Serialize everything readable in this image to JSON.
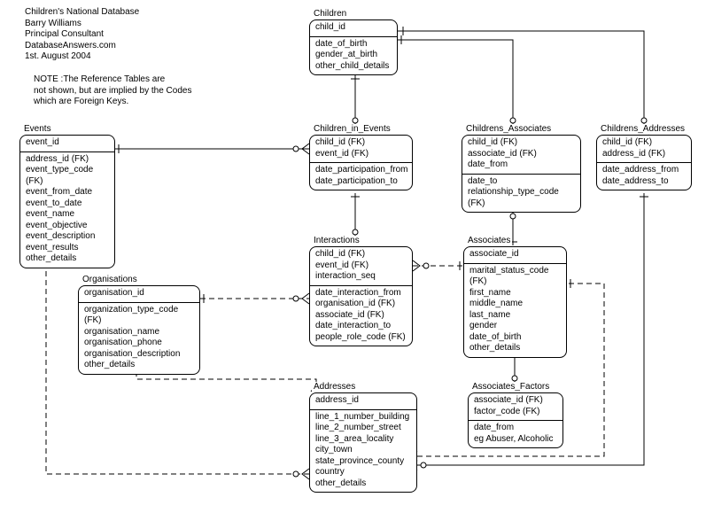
{
  "meta": {
    "line1": "Children's National Database",
    "line2": "Barry Williams",
    "line3": "Principal Consultant",
    "line4": "DatabaseAnswers.com",
    "line5": "1st. August 2004"
  },
  "note": {
    "line1": "NOTE :The Reference Tables are",
    "line2": "not shown, but are implied by the Codes",
    "line3": "which are Foreign Keys."
  },
  "entities": {
    "children": {
      "title": "Children",
      "pk": [
        "child_id"
      ],
      "attrs": [
        "date_of_birth",
        "gender_at_birth",
        "other_child_details"
      ]
    },
    "children_in_events": {
      "title": "Children_in_Events",
      "pk": [
        "child_id (FK)",
        "event_id (FK)"
      ],
      "attrs": [
        "date_participation_from",
        "date_participation_to"
      ]
    },
    "childrens_associates": {
      "title": "Childrens_Associates",
      "pk": [
        "child_id (FK)",
        "associate_id (FK)",
        "date_from"
      ],
      "attrs": [
        "date_to",
        "relationship_type_code (FK)"
      ]
    },
    "childrens_addresses": {
      "title": "Childrens_Addresses",
      "pk": [
        "child_id (FK)",
        "address_id (FK)"
      ],
      "attrs": [
        "date_address_from",
        "date_address_to"
      ]
    },
    "events": {
      "title": "Events",
      "pk": [
        "event_id"
      ],
      "attrs": [
        "address_id (FK)",
        "event_type_code (FK)",
        "event_from_date",
        "event_to_date",
        "event_name",
        "event_objective",
        "event_description",
        "event_results",
        "other_details"
      ]
    },
    "interactions": {
      "title": "Interactions",
      "pk": [
        "child_id (FK)",
        "event_id (FK)",
        "interaction_seq"
      ],
      "attrs": [
        "date_interaction_from",
        "organisation_id (FK)",
        "associate_id (FK)",
        "date_interaction_to",
        "people_role_code (FK)"
      ]
    },
    "associates": {
      "title": "Associates",
      "pk": [
        "associate_id"
      ],
      "attrs": [
        "marital_status_code (FK)",
        "first_name",
        "middle_name",
        "last_name",
        "gender",
        "date_of_birth",
        "other_details"
      ]
    },
    "organisations": {
      "title": "Organisations",
      "pk": [
        "organisation_id"
      ],
      "attrs": [
        "organization_type_code (FK)",
        "organisation_name",
        "organisation_phone",
        "organisation_description",
        "other_details"
      ]
    },
    "addresses": {
      "title": "Addresses",
      "pk": [
        "address_id"
      ],
      "attrs": [
        "line_1_number_building",
        "line_2_number_street",
        "line_3_area_locality",
        "city_town",
        "state_province_county",
        "country",
        "other_details"
      ]
    },
    "associates_factors": {
      "title": "Associates_Factors",
      "pk": [
        "associate_id (FK)",
        "factor_code (FK)"
      ],
      "attrs": [
        "date_from",
        "eg Abuser, Alcoholic"
      ]
    }
  }
}
